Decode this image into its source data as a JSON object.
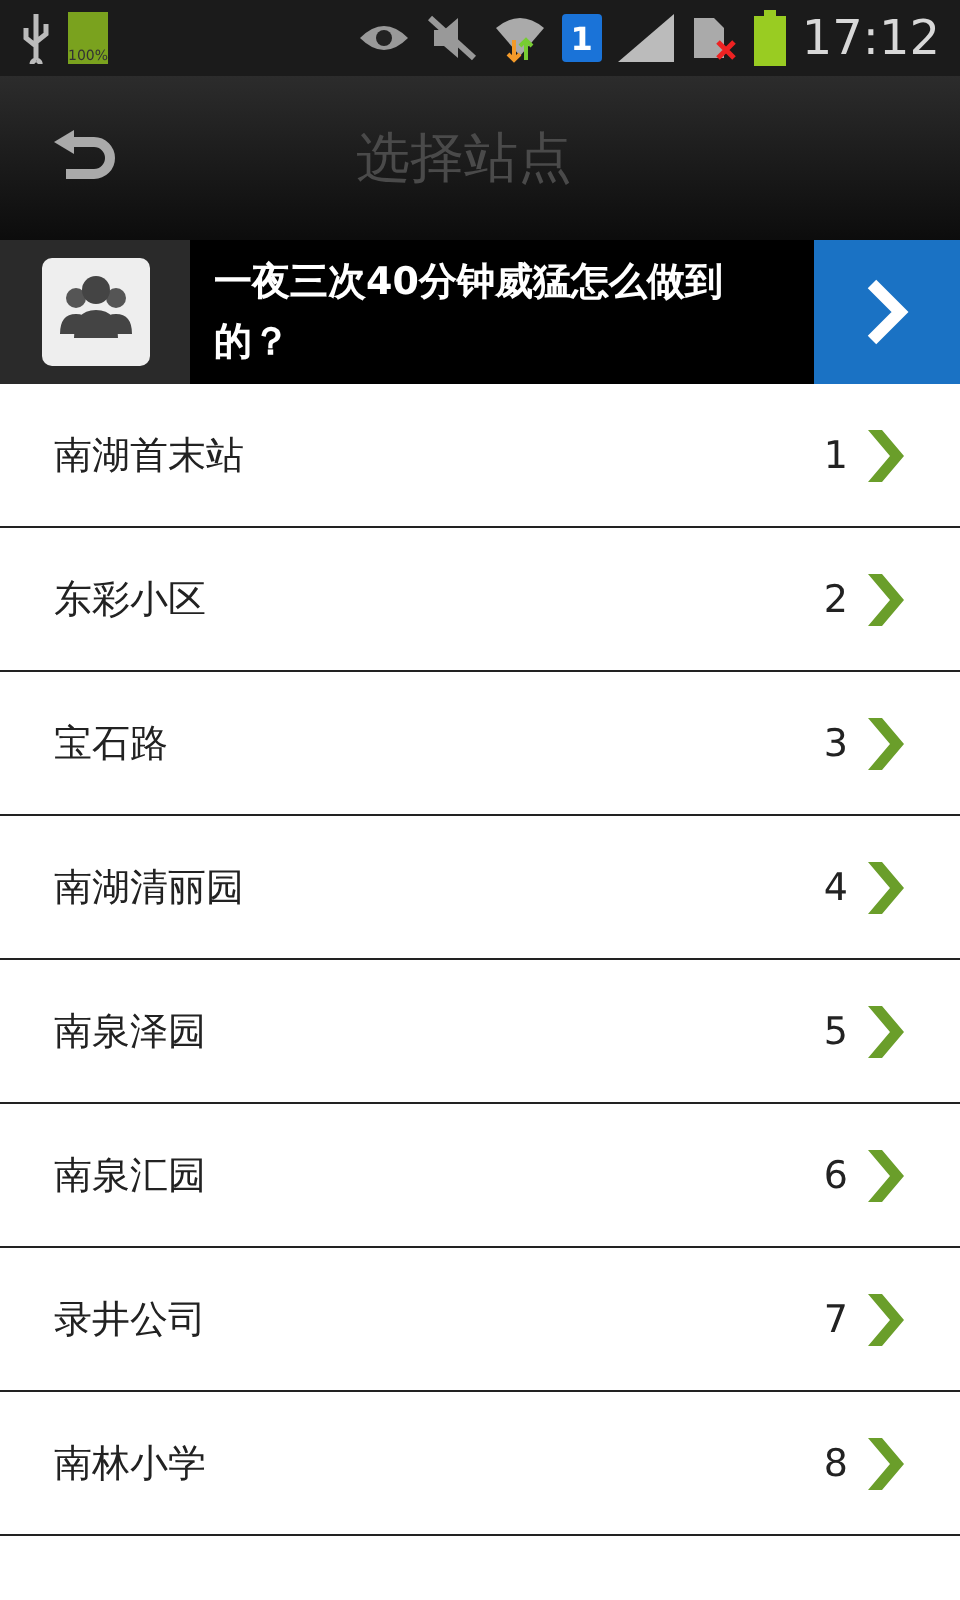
{
  "status_bar": {
    "battery_small_label": "100%",
    "sim_badge": "1",
    "time": "17:12"
  },
  "header": {
    "title": "选择站点"
  },
  "ad": {
    "text": "一夜三次40分钟威猛怎么做到的？"
  },
  "stations": [
    {
      "name": "南湖首末站",
      "number": "1"
    },
    {
      "name": "东彩小区",
      "number": "2"
    },
    {
      "name": "宝石路",
      "number": "3"
    },
    {
      "name": "南湖清丽园",
      "number": "4"
    },
    {
      "name": "南泉泽园",
      "number": "5"
    },
    {
      "name": "南泉汇园",
      "number": "6"
    },
    {
      "name": "录井公司",
      "number": "7"
    },
    {
      "name": "南林小学",
      "number": "8"
    }
  ]
}
